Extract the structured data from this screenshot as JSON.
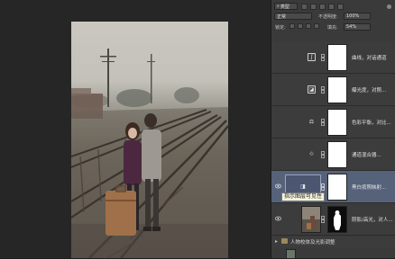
{
  "filter": {
    "label": "类型"
  },
  "blend": {
    "mode": "正常",
    "opacity_label": "不透明度:",
    "opacity_value": "100%"
  },
  "lock": {
    "label": "锁定:",
    "fill_label": "填充:",
    "fill_value": "54%"
  },
  "layers": [
    {
      "name": "曲线，对话通道",
      "icon": "curves-icon",
      "selected": false
    },
    {
      "name": "曝光度，对照...",
      "icon": "exposure-icon",
      "selected": false
    },
    {
      "name": "色彩平衡，对比...",
      "icon": "color-balance-icon",
      "selected": false
    },
    {
      "name": "通道混合器...",
      "icon": "channel-mixer-icon",
      "selected": false
    },
    {
      "name": "黑白按照映射...",
      "icon": "black-white-icon",
      "selected": true
    },
    {
      "name": "阴影/高光，对人...",
      "icon": "photo-layer",
      "selected": false
    }
  ],
  "tooltip": "指示图层可见性",
  "group": {
    "name": "人物校体及光影调整"
  },
  "colors": {
    "panel": "#3a3a3a",
    "selected": "#56627a",
    "canvas": "#262626"
  }
}
